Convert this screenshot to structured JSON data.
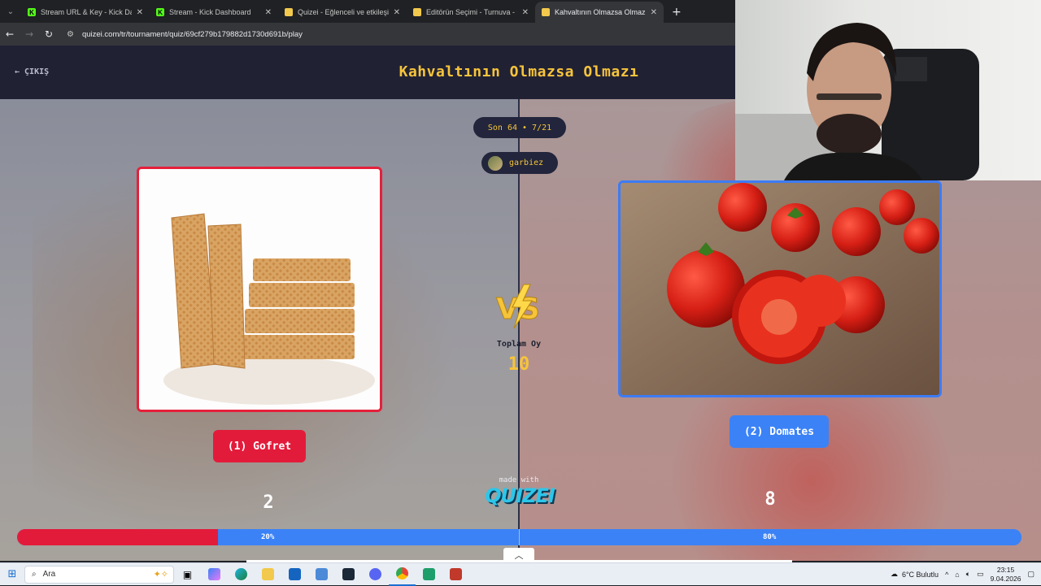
{
  "browser": {
    "tabs": [
      {
        "label": "Stream URL & Key - Kick Dashb",
        "favicon": "kick-icon",
        "active": false
      },
      {
        "label": "Stream - Kick Dashboard",
        "favicon": "kick-icon",
        "active": false
      },
      {
        "label": "Quizei - Eğlenceli ve etkileşimli",
        "favicon": "quizei-icon",
        "active": false
      },
      {
        "label": "Editörün Seçimi - Turnuva - Qui",
        "favicon": "quizei-icon",
        "active": false
      },
      {
        "label": "Kahvaltının Olmazsa Olmazı - T",
        "favicon": "quizei-icon",
        "active": true
      }
    ],
    "url": "quizei.com/tr/tournament/quiz/69cf279b179882d1730d691b/play"
  },
  "header": {
    "exit_label": "ÇIKIŞ",
    "title": "Kahvaltının Olmazsa Olmazı"
  },
  "round": {
    "label": "Son 64 • 7/21",
    "user": "garbiez"
  },
  "vs": {
    "total_label": "Toplam Oy",
    "total_value": "10"
  },
  "left": {
    "label": "(1) Gofret",
    "votes": "2",
    "percent_label": "20%",
    "percent": 20,
    "color": "#e31b3b"
  },
  "right": {
    "label": "(2) Domates",
    "votes": "8",
    "percent_label": "80%",
    "percent": 80,
    "color": "#3b82f6"
  },
  "branding": {
    "made_with": "made with",
    "logo": "QUIZEI"
  },
  "taskbar": {
    "search_placeholder": "Ara",
    "weather": "6°C Bulutlu",
    "time": "23:15",
    "date": "9.04.2026"
  },
  "colors": {
    "accent_yellow": "#f6c43b",
    "header_bg": "#212134"
  }
}
